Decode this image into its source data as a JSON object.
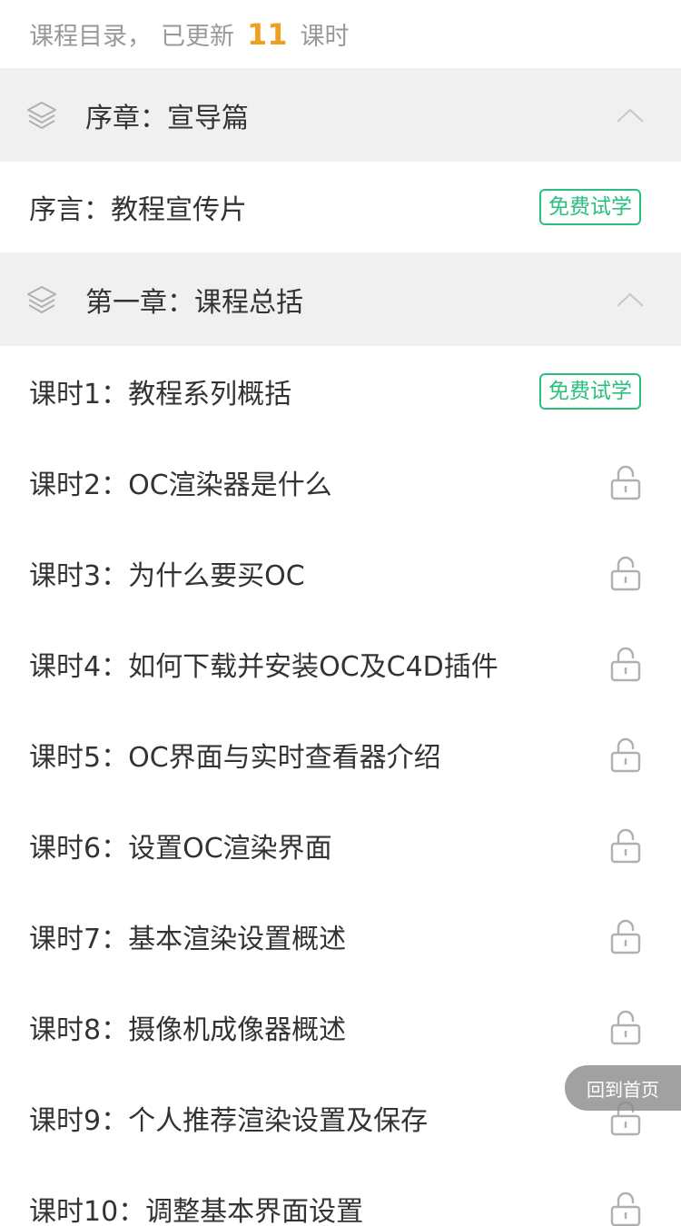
{
  "header": {
    "prefix": "课程目录，",
    "updated_label": "已更新",
    "count": "11",
    "unit": "课时"
  },
  "chapters": [
    {
      "title": "序章：宣导篇",
      "lessons": [
        {
          "title": "序言：教程宣传片",
          "badge": "免费试学"
        }
      ]
    },
    {
      "title": "第一章：课程总括",
      "lessons": [
        {
          "title": "课时1：教程系列概括",
          "badge": "免费试学"
        },
        {
          "title": "课时2：OC渲染器是什么",
          "icon": "lock-icon"
        },
        {
          "title": "课时3：为什么要买OC",
          "icon": "lock-icon"
        },
        {
          "title": "课时4：如何下载并安装OC及C4D插件",
          "icon": "lock-icon"
        },
        {
          "title": "课时5：OC界面与实时查看器介绍",
          "icon": "lock-icon"
        },
        {
          "title": "课时6：设置OC渲染界面",
          "icon": "lock-icon"
        },
        {
          "title": "课时7：基本渲染设置概述",
          "icon": "lock-icon"
        },
        {
          "title": "课时8：摄像机成像器概述",
          "icon": "lock-icon"
        },
        {
          "title": "课时9：个人推荐渲染设置及保存",
          "icon": "lock-icon"
        },
        {
          "title": "课时10：调整基本界面设置",
          "icon": "lock-icon"
        }
      ]
    }
  ],
  "back_home": {
    "label": "回到首页"
  },
  "colors": {
    "accent_count": "#f0a020",
    "free_badge": "#2bbf7e",
    "chapter_bg": "#f0f0f0",
    "icon_gray": "#b0b0b0"
  }
}
